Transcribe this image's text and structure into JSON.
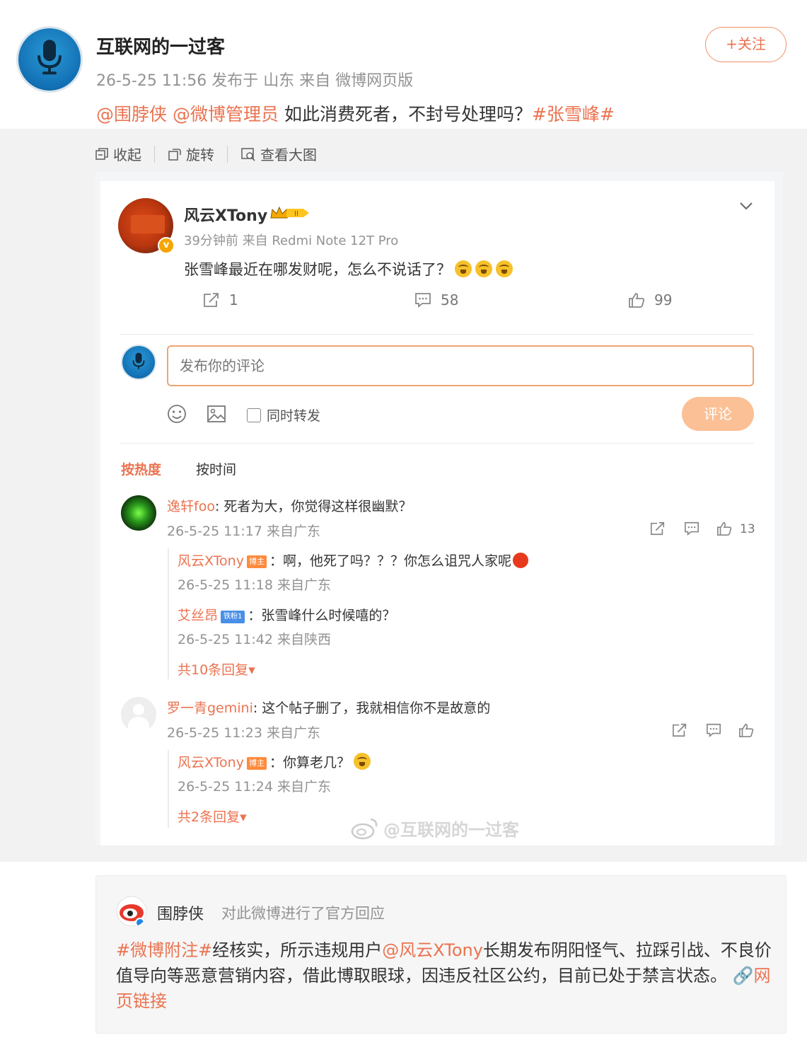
{
  "post": {
    "author": "互联网的一过客",
    "meta": "26-5-25 11:56 发布于 山东 来自 微博网页版",
    "follow_label": "+关注",
    "text_mention1": "@围脖侠",
    "text_mention2": "@微博管理员",
    "text_body": "如此消费死者，不封号处理吗？",
    "text_topic": "#张雪峰#"
  },
  "image_tools": [
    {
      "label": "收起",
      "icon": "collapse-icon"
    },
    {
      "label": "旋转",
      "icon": "rotate-icon"
    },
    {
      "label": "查看大图",
      "icon": "zoom-image-icon"
    }
  ],
  "screenshot": {
    "author": "风云XTony",
    "meta": "39分钟前 来自 Redmi Note 12T Pro",
    "text": "张雪峰最近在哪发财呢，怎么不说话了？",
    "stats": {
      "repost": "1",
      "comment": "58",
      "like": "99"
    },
    "comment_placeholder": "发布你的评论",
    "repost_check_label": "同时转发",
    "comment_button": "评论",
    "sort_hot": "按热度",
    "sort_time": "按时间",
    "comments": [
      {
        "user": "逸轩foo",
        "text": ": 死者为大，你觉得这样很幽默？",
        "meta": "26-5-25 11:17 来自广东",
        "likes": "13",
        "replies": [
          {
            "user": "风云XTony",
            "tag": "博主",
            "text": "：啊，他死了吗？？？你怎么诅咒人家呢",
            "meta": "26-5-25 11:18 来自广东"
          },
          {
            "user": "艾丝昂",
            "tag": "铁粉1",
            "text": "：张雪峰什么时候嘻的？",
            "meta": "26-5-25 11:42 来自陕西"
          }
        ],
        "more": "共10条回复"
      },
      {
        "user": "罗一青gemini",
        "text": ": 这个帖子删了，我就相信你不是故意的",
        "meta": "26-5-25 11:23 来自广东",
        "likes": "",
        "replies": [
          {
            "user": "风云XTony",
            "tag": "博主",
            "text": "：你算老几？",
            "meta": "26-5-25 11:24 来自广东"
          }
        ],
        "more": "共2条回复"
      }
    ],
    "watermark": "@互联网的一过客"
  },
  "official": {
    "name": "围脖侠",
    "desc": "对此微博进行了官方回应",
    "topic": "#微博附注#",
    "body1": "经核实，所示违规用户",
    "mention": "@风云XTony",
    "body2": "长期发布阴阳怪气、拉踩引战、不良价值导向等恶意营销内容，借此博取眼球，因违反社区公约，目前已处于禁言状态。",
    "link": "网页链接"
  },
  "colors": {
    "accent": "#eb7350",
    "meta_gray": "#939393",
    "band_bg": "#f2f2f2"
  }
}
